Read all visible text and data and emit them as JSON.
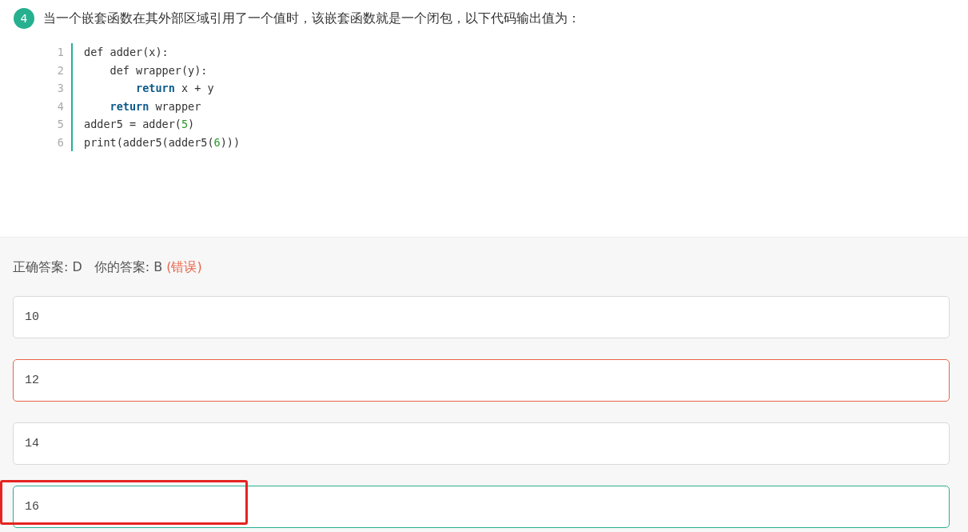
{
  "question": {
    "number": "4",
    "text": "当一个嵌套函数在其外部区域引用了一个值时，该嵌套函数就是一个闭包，以下代码输出值为："
  },
  "code": [
    {
      "number": "1",
      "tokens": [
        {
          "text": "def adder(x):",
          "kind": "plain"
        }
      ]
    },
    {
      "number": "2",
      "tokens": [
        {
          "text": "    def wrapper(y):",
          "kind": "plain"
        }
      ]
    },
    {
      "number": "3",
      "tokens": [
        {
          "text": "        return",
          "kind": "keyword"
        },
        {
          "text": " x + y",
          "kind": "plain"
        }
      ]
    },
    {
      "number": "4",
      "tokens": [
        {
          "text": "    return",
          "kind": "keyword"
        },
        {
          "text": " wrapper",
          "kind": "plain"
        }
      ]
    },
    {
      "number": "5",
      "tokens": [
        {
          "text": "adder5 = adder(",
          "kind": "plain"
        },
        {
          "text": "5",
          "kind": "number"
        },
        {
          "text": ")",
          "kind": "plain"
        }
      ]
    },
    {
      "number": "6",
      "tokens": [
        {
          "text": "print(adder5(adder5(",
          "kind": "plain"
        },
        {
          "text": "6",
          "kind": "number"
        },
        {
          "text": ")))",
          "kind": "plain"
        }
      ]
    }
  ],
  "result": {
    "correct_answer": "正确答案: D",
    "your_answer": "你的答案: B",
    "verdict": "(错误)"
  },
  "options": [
    {
      "text": "10",
      "wrong": false,
      "correct": false,
      "highlighted": false
    },
    {
      "text": "12",
      "wrong": true,
      "correct": false,
      "highlighted": false
    },
    {
      "text": "14",
      "wrong": false,
      "correct": false,
      "highlighted": false
    },
    {
      "text": "16",
      "wrong": false,
      "correct": true,
      "highlighted": true
    }
  ]
}
